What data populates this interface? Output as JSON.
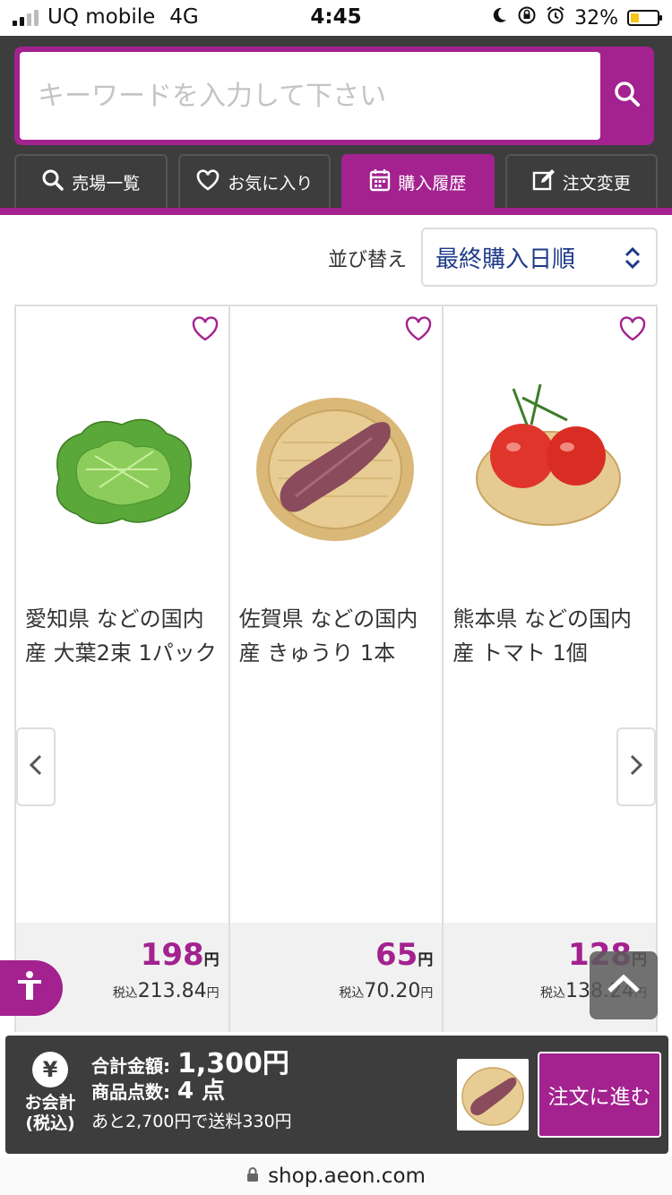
{
  "status_bar": {
    "carrier": "UQ mobile",
    "network": "4G",
    "time": "4:45",
    "battery": "32%",
    "battery_level": 0.32
  },
  "search": {
    "placeholder": "キーワードを入力して下さい",
    "button_icon": "search-icon"
  },
  "tabs": [
    {
      "label": "売場一覧",
      "icon": "search-icon",
      "active": false
    },
    {
      "label": "お気に入り",
      "icon": "heart-icon",
      "active": false
    },
    {
      "label": "購入履歴",
      "icon": "calendar-icon",
      "active": true
    },
    {
      "label": "注文変更",
      "icon": "edit-icon",
      "active": false
    }
  ],
  "sort": {
    "label": "並び替え",
    "value": "最終購入日順"
  },
  "products": [
    {
      "name": "愛知県 などの国内産 大葉2束 1パック",
      "price": "198",
      "yen": "円",
      "tax_label": "税込",
      "tax_price": "213.84",
      "image": "shiso-leaves"
    },
    {
      "name": "佐賀県 などの国内産 きゅうり 1本",
      "price": "65",
      "yen": "円",
      "tax_label": "税込",
      "tax_price": "70.20",
      "image": "sweet-potato-on-basket"
    },
    {
      "name": "熊本県 などの国内産 トマト 1個",
      "price": "128",
      "yen": "円",
      "tax_label": "税込",
      "tax_price": "138.24",
      "image": "tomatoes-on-basket"
    }
  ],
  "cart": {
    "yen_symbol": "¥",
    "label": "お会計\n(税込)",
    "total_label": "合計金額:",
    "total_value": "1,300円",
    "count_label": "商品点数:",
    "count_value": "4 点",
    "note": "あと2,700円で送料330円",
    "checkout": "注文に進む"
  },
  "url": "shop.aeon.com",
  "colors": {
    "brand": "#a3228f",
    "header_bg": "#3d3d3d",
    "sort_text": "#1f3a8a"
  }
}
